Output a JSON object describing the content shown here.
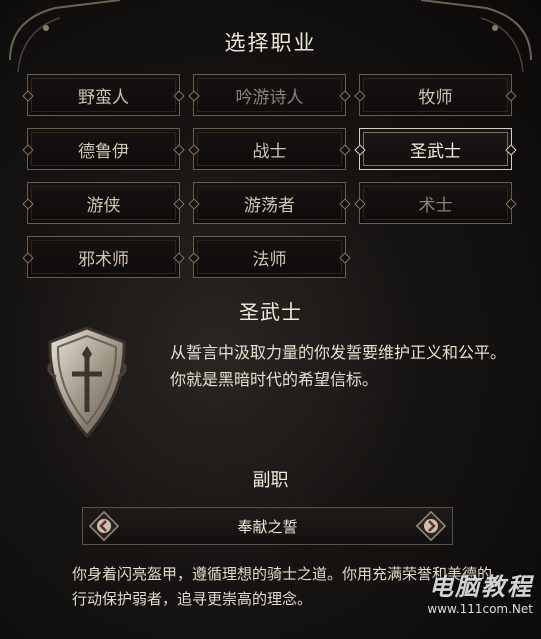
{
  "header": {
    "title": "选择职业"
  },
  "classes": [
    {
      "label": "野蛮人",
      "state": "normal"
    },
    {
      "label": "吟游诗人",
      "state": "disabled"
    },
    {
      "label": "牧师",
      "state": "normal"
    },
    {
      "label": "德鲁伊",
      "state": "normal"
    },
    {
      "label": "战士",
      "state": "normal"
    },
    {
      "label": "圣武士",
      "state": "selected"
    },
    {
      "label": "游侠",
      "state": "normal"
    },
    {
      "label": "游荡者",
      "state": "normal"
    },
    {
      "label": "术士",
      "state": "disabled"
    },
    {
      "label": "邪术师",
      "state": "normal"
    },
    {
      "label": "法师",
      "state": "normal"
    }
  ],
  "selected_class": {
    "name": "圣武士",
    "description": "从誓言中汲取力量的你发誓要维护正义和公平。你就是黑暗时代的希望信标。",
    "emblem_icon": "paladin-shield-icon"
  },
  "subclass": {
    "title": "副职",
    "value": "奉献之誓",
    "prev_icon": "chevron-left-icon",
    "next_icon": "chevron-right-icon",
    "description": "你身着闪亮盔甲，遵循理想的骑士之道。你用充满荣誉和美德的行动保护弱者，追寻更崇高的理念。"
  },
  "watermark": {
    "text": "电脑教程",
    "url": "www.111com.Net"
  },
  "colors": {
    "accent_border": "#d9cdb9",
    "normal_border": "#6d5c4c",
    "text": "#e6dccb"
  }
}
